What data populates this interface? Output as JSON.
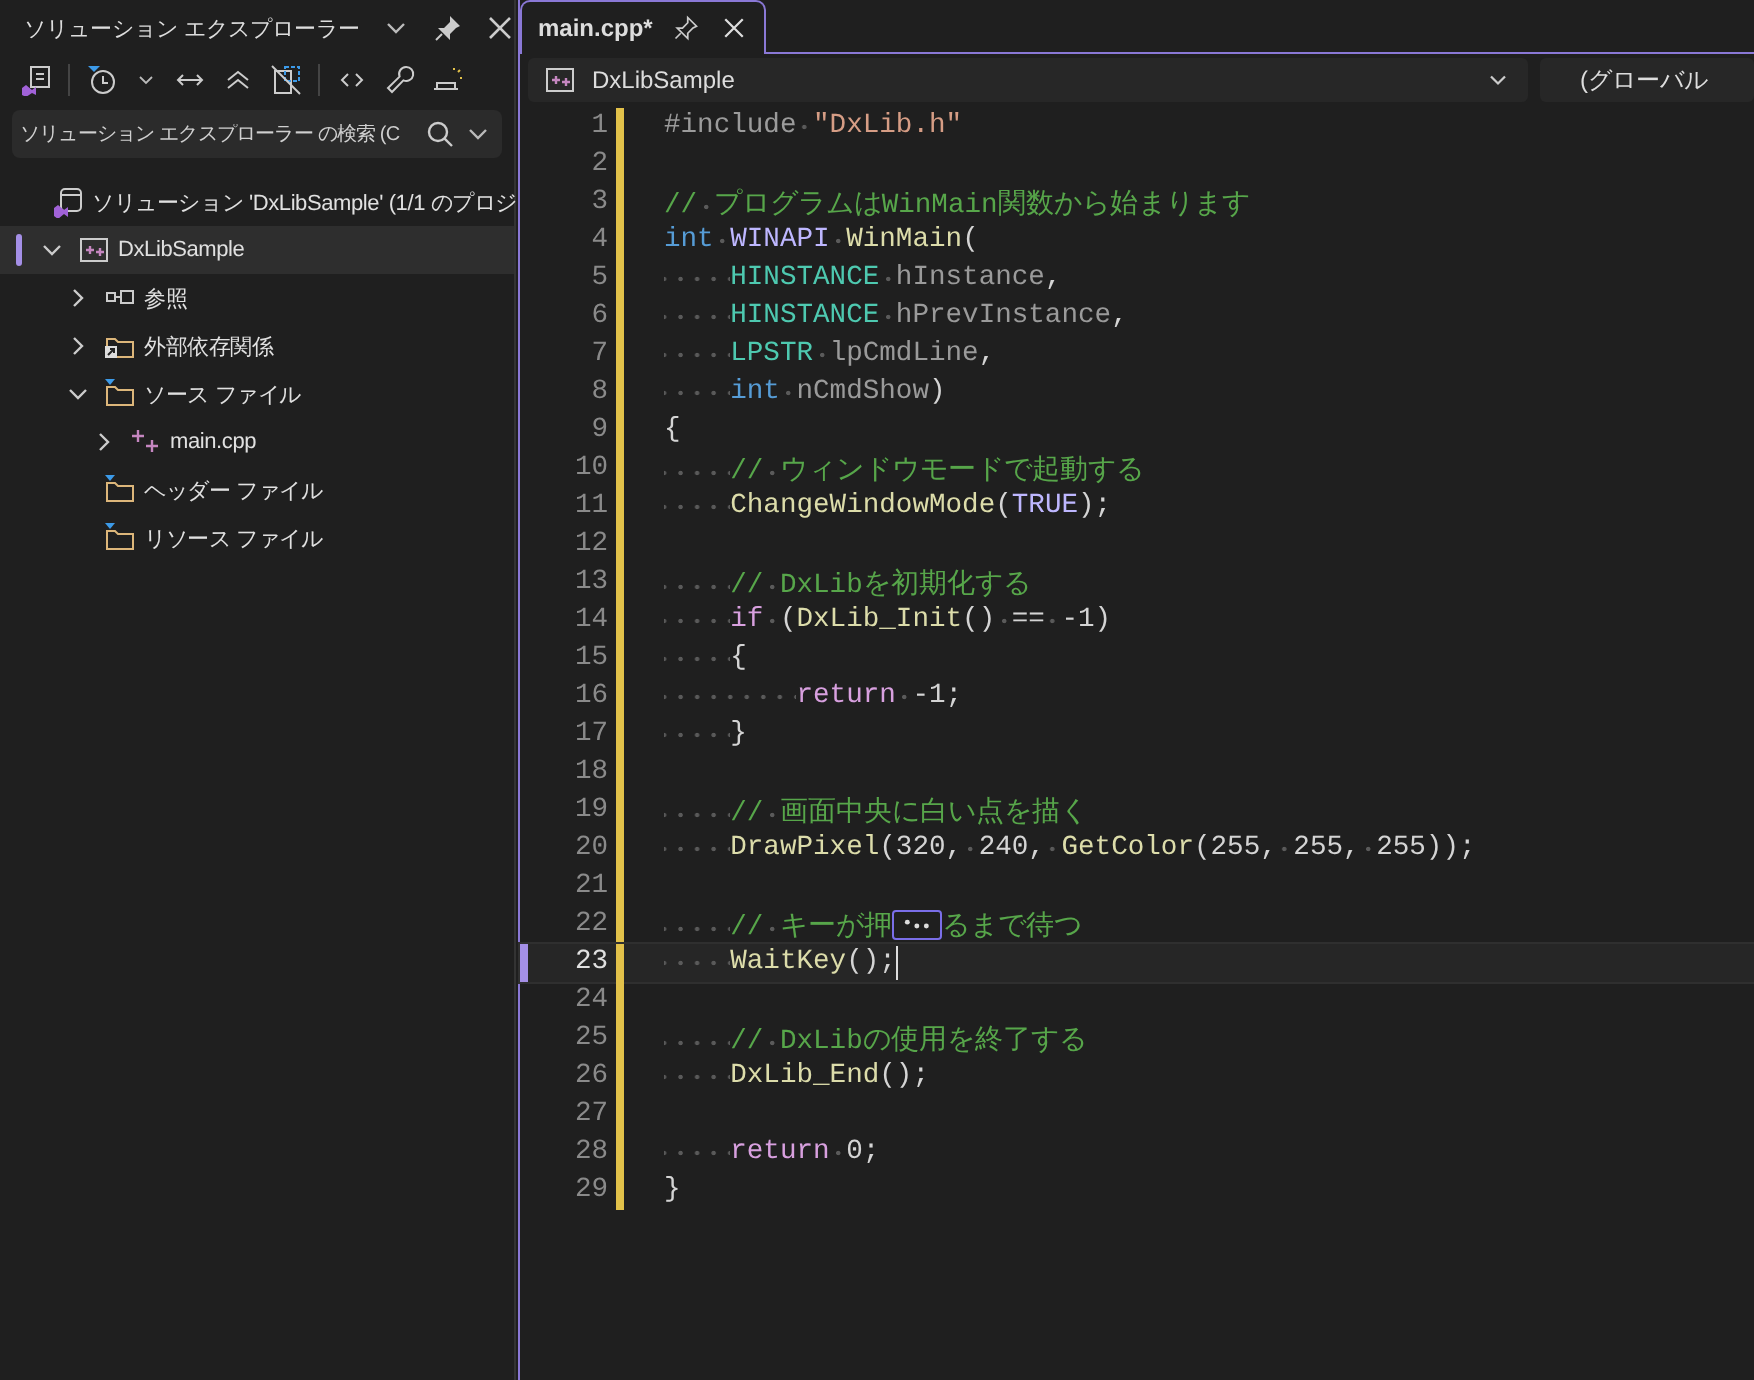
{
  "explorer": {
    "title": "ソリューション エクスプローラー",
    "search": {
      "placeholder": "ソリューション エクスプローラー の検索 (C"
    },
    "tree": [
      {
        "label": "ソリューション 'DxLibSample' (1/1 のプロジ",
        "kind": "solution",
        "selected": false,
        "children": [
          {
            "label": "DxLibSample",
            "kind": "project",
            "selected": true,
            "expanded": true,
            "children": [
              {
                "label": "参照",
                "kind": "references",
                "selected": false,
                "expanded": false
              },
              {
                "label": "外部依存関係",
                "kind": "external",
                "selected": false,
                "expanded": false
              },
              {
                "label": "ソース ファイル",
                "kind": "filter",
                "selected": false,
                "expanded": true,
                "children": [
                  {
                    "label": "main.cpp",
                    "kind": "cpp",
                    "selected": false,
                    "expanded": false
                  }
                ]
              },
              {
                "label": "ヘッダー ファイル",
                "kind": "filter",
                "selected": false
              },
              {
                "label": "リソース ファイル",
                "kind": "filter",
                "selected": false
              }
            ]
          }
        ]
      }
    ]
  },
  "editor": {
    "tabs": [
      {
        "label": "main.cpp*",
        "selected": true
      }
    ],
    "nav": {
      "project": "DxLibSample",
      "scope": "(グローバル"
    },
    "lines": [
      {
        "n": "1",
        "modified": true,
        "selected": false,
        "tokens": [
          {
            "kind": "pp",
            "text": "#include"
          },
          {
            "kind": "str",
            "text": " \"DxLib.h\""
          }
        ]
      },
      {
        "n": "2",
        "modified": true,
        "selected": false
      },
      {
        "n": "3",
        "modified": true,
        "selected": false,
        "tokens": [
          {
            "kind": "cmt",
            "text": "// プログラムはWinMain関数から始まります"
          }
        ]
      },
      {
        "n": "4",
        "modified": true,
        "selected": false,
        "tokens": [
          {
            "kind": "kw",
            "text": "int"
          },
          {
            "kind": "macro",
            "text": " WINAPI"
          },
          {
            "kind": "fn",
            "text": " WinMain"
          },
          {
            "kind": "p",
            "text": "("
          }
        ]
      },
      {
        "n": "5",
        "modified": true,
        "selected": false,
        "tokens": [
          {
            "kind": "type",
            "text": "    HINSTANCE"
          },
          {
            "kind": "param",
            "text": " hInstance"
          },
          {
            "kind": "p",
            "text": ","
          }
        ]
      },
      {
        "n": "6",
        "modified": true,
        "selected": false,
        "tokens": [
          {
            "kind": "type",
            "text": "    HINSTANCE"
          },
          {
            "kind": "param",
            "text": " hPrevInstance"
          },
          {
            "kind": "p",
            "text": ","
          }
        ]
      },
      {
        "n": "7",
        "modified": true,
        "selected": false,
        "tokens": [
          {
            "kind": "type",
            "text": "    LPSTR"
          },
          {
            "kind": "param",
            "text": " lpCmdLine"
          },
          {
            "kind": "p",
            "text": ","
          }
        ]
      },
      {
        "n": "8",
        "modified": true,
        "selected": false,
        "tokens": [
          {
            "kind": "kw",
            "text": "    int"
          },
          {
            "kind": "param",
            "text": " nCmdShow"
          },
          {
            "kind": "p",
            "text": ")"
          }
        ]
      },
      {
        "n": "9",
        "modified": true,
        "selected": false,
        "tokens": [
          {
            "kind": "p",
            "text": "{"
          }
        ]
      },
      {
        "n": "10",
        "modified": true,
        "selected": false,
        "tokens": [
          {
            "kind": "cmt",
            "text": "    // ウィンドウモードで起動する"
          }
        ]
      },
      {
        "n": "11",
        "modified": true,
        "selected": false,
        "tokens": [
          {
            "kind": "fn",
            "text": "    ChangeWindowMode"
          },
          {
            "kind": "p",
            "text": "("
          },
          {
            "kind": "macro",
            "text": "TRUE"
          },
          {
            "kind": "p",
            "text": ");"
          }
        ]
      },
      {
        "n": "12",
        "modified": true,
        "selected": false
      },
      {
        "n": "13",
        "modified": true,
        "selected": false,
        "tokens": [
          {
            "kind": "cmt",
            "text": "    // DxLibを初期化する"
          }
        ]
      },
      {
        "n": "14",
        "modified": true,
        "selected": false,
        "tokens": [
          {
            "kind": "ctl",
            "text": "    if"
          },
          {
            "kind": "p",
            "text": " ("
          },
          {
            "kind": "fn",
            "text": "DxLib_Init"
          },
          {
            "kind": "p",
            "text": "() == -1)"
          }
        ]
      },
      {
        "n": "15",
        "modified": true,
        "selected": false,
        "tokens": [
          {
            "kind": "p",
            "text": "    {"
          }
        ]
      },
      {
        "n": "16",
        "modified": true,
        "selected": false,
        "tokens": [
          {
            "kind": "ctl",
            "text": "        return"
          },
          {
            "kind": "p",
            "text": " -1;"
          }
        ]
      },
      {
        "n": "17",
        "modified": true,
        "selected": false,
        "tokens": [
          {
            "kind": "p",
            "text": "    }"
          }
        ]
      },
      {
        "n": "18",
        "modified": true,
        "selected": false
      },
      {
        "n": "19",
        "modified": true,
        "selected": false,
        "tokens": [
          {
            "kind": "cmt",
            "text": "    // 画面中央に白い点を描く"
          }
        ]
      },
      {
        "n": "20",
        "modified": true,
        "selected": false,
        "tokens": [
          {
            "kind": "fn",
            "text": "    DrawPixel"
          },
          {
            "kind": "p",
            "text": "(320, 240, "
          },
          {
            "kind": "fn",
            "text": "GetColor"
          },
          {
            "kind": "p",
            "text": "(255, 255, 255));"
          }
        ]
      },
      {
        "n": "21",
        "modified": true,
        "selected": false
      },
      {
        "n": "22",
        "modified": true,
        "selected": false,
        "tokens": [
          {
            "kind": "cmt",
            "text": "    // キーが押"
          },
          {
            "kind": "hint"
          },
          {
            "kind": "cmt",
            "text": "るまで待つ"
          }
        ]
      },
      {
        "n": "23",
        "modified": true,
        "selected": true,
        "tokens": [
          {
            "kind": "fn",
            "text": "    WaitKey"
          },
          {
            "kind": "p",
            "text": "();"
          }
        ]
      },
      {
        "n": "24",
        "modified": true,
        "selected": false
      },
      {
        "n": "25",
        "modified": true,
        "selected": false,
        "tokens": [
          {
            "kind": "cmt",
            "text": "    // DxLibの使用を終了する"
          }
        ]
      },
      {
        "n": "26",
        "modified": true,
        "selected": false,
        "tokens": [
          {
            "kind": "fn",
            "text": "    DxLib_End"
          },
          {
            "kind": "p",
            "text": "();"
          }
        ]
      },
      {
        "n": "27",
        "modified": true,
        "selected": false
      },
      {
        "n": "28",
        "modified": true,
        "selected": false,
        "tokens": [
          {
            "kind": "ctl",
            "text": "    return"
          },
          {
            "kind": "p",
            "text": " 0;"
          }
        ]
      },
      {
        "n": "29",
        "modified": true,
        "selected": false,
        "tokens": [
          {
            "kind": "p",
            "text": "}"
          }
        ]
      }
    ]
  }
}
